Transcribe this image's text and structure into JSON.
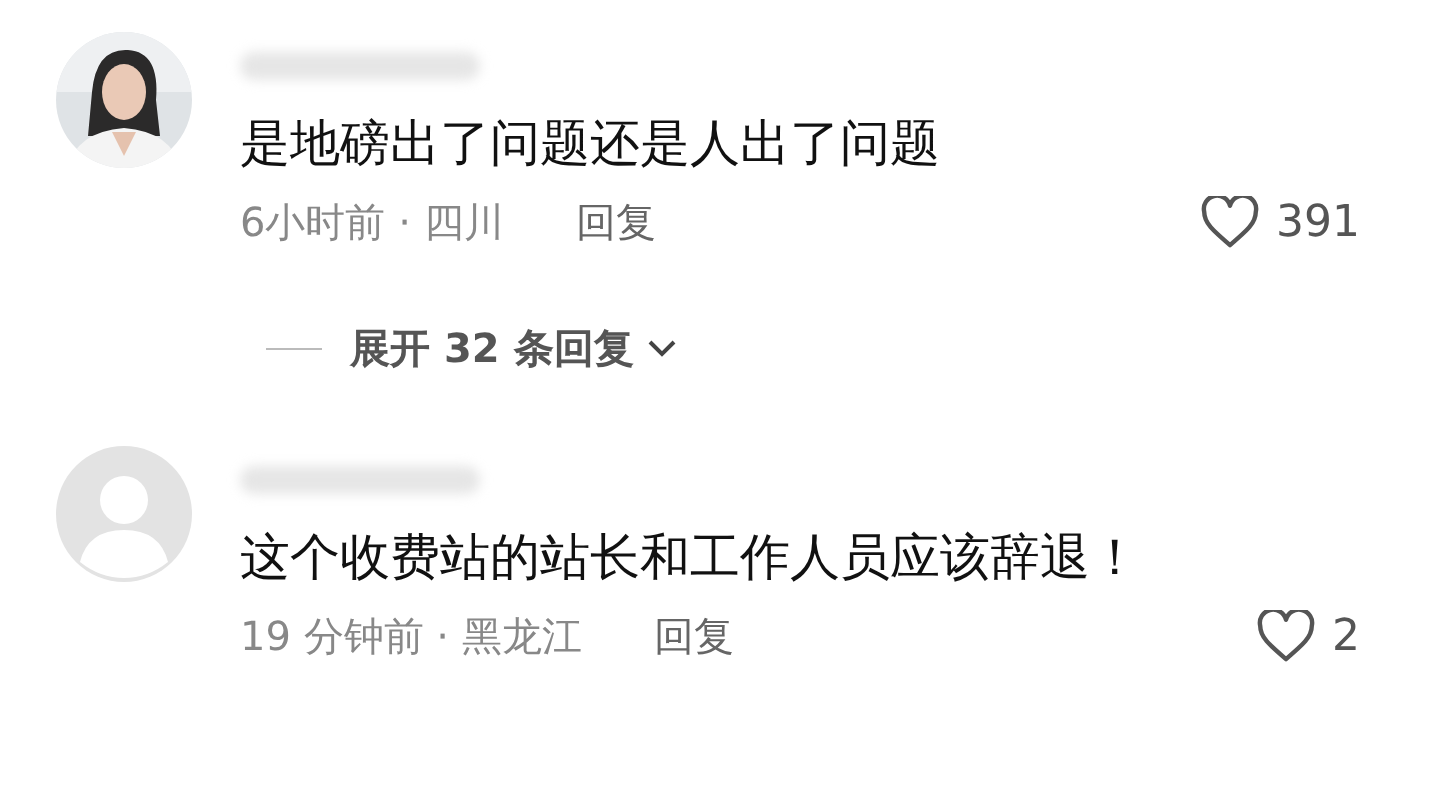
{
  "items": [
    {
      "kind": "comment",
      "text": "是地磅出了问题还是人出了问题",
      "meta": "6小时前 · 四川",
      "reply": "回复",
      "likes": "391"
    },
    {
      "kind": "expand",
      "label": "展开 32 条回复"
    },
    {
      "kind": "comment",
      "avatar": {
        "kind": "default"
      },
      "text": "这个收费站的站长和工作人员应该辞退！",
      "meta": "19 分钟前 · 黑龙江",
      "reply": "回复",
      "likes": "2"
    }
  ]
}
